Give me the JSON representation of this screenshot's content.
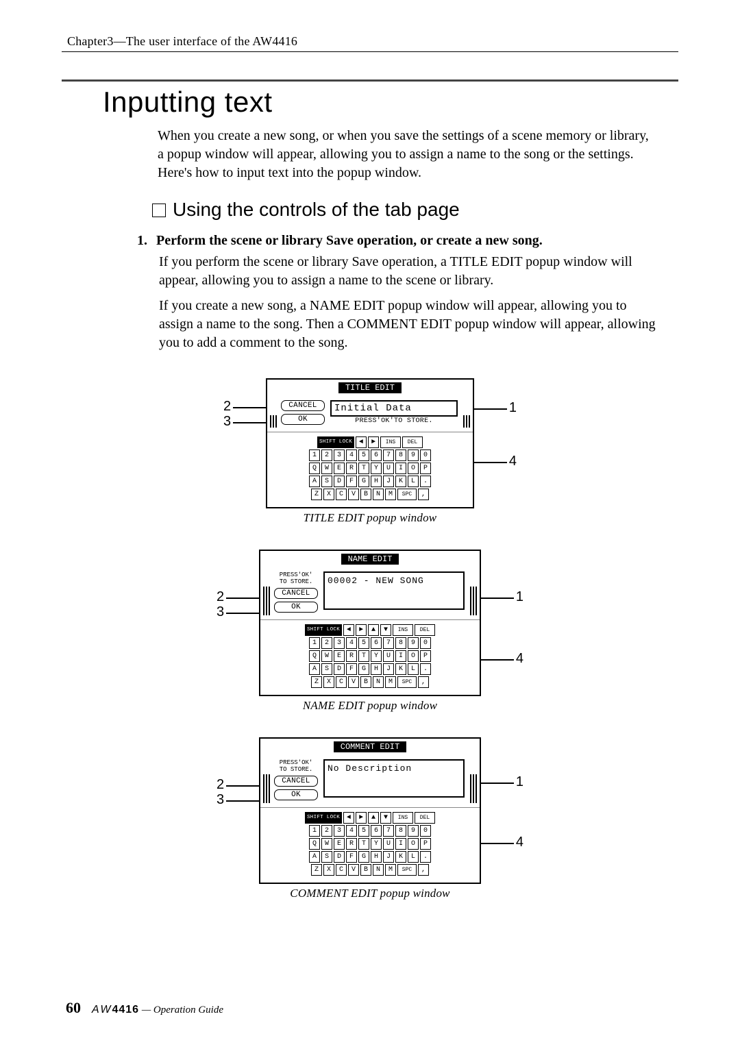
{
  "header": "Chapter3—The user interface of the AW4416",
  "title": "Inputting text",
  "intro": "When you create a new song, or when you save the settings of a scene memory or library, a popup window will appear, allowing you to assign a name to the song or the settings. Here's how to input text into the popup window.",
  "subhead": "Using the controls of the tab page",
  "step_num": "1.",
  "step_title": "Perform the scene or library Save operation, or create a new song.",
  "step_p1": "If you perform the scene or library Save operation, a TITLE EDIT popup window will appear, allowing you to assign a name to the scene or library.",
  "step_p2": "If you create a new song, a NAME EDIT popup window will appear, allowing you to assign a name to the song. Then a COMMENT EDIT popup window will appear, allowing you to add a comment to the song.",
  "popups": {
    "title_edit": {
      "bar": "TITLE EDIT",
      "field": "Initial Data",
      "below": "PRESS'OK'TO STORE.",
      "caption": "TITLE EDIT popup window"
    },
    "name_edit": {
      "bar": "NAME EDIT",
      "prompt1": "PRESS'OK'",
      "prompt2": "TO STORE.",
      "field": "00002 - NEW SONG",
      "caption": "NAME EDIT popup window"
    },
    "comment_edit": {
      "bar": "COMMENT EDIT",
      "prompt1": "PRESS'OK'",
      "prompt2": "TO STORE.",
      "field": "No Description",
      "caption": "COMMENT EDIT popup window"
    }
  },
  "buttons": {
    "cancel": "CANCEL",
    "ok": "OK"
  },
  "kb": {
    "shift": "SHIFT LOCK",
    "ins": "INS",
    "del": "DEL",
    "spc": "SPC",
    "row1": [
      "1",
      "2",
      "3",
      "4",
      "5",
      "6",
      "7",
      "8",
      "9",
      "0"
    ],
    "row2": [
      "Q",
      "W",
      "E",
      "R",
      "T",
      "Y",
      "U",
      "I",
      "O",
      "P"
    ],
    "row3": [
      "A",
      "S",
      "D",
      "F",
      "G",
      "H",
      "J",
      "K",
      "L",
      "."
    ],
    "row4": [
      "Z",
      "X",
      "C",
      "V",
      "B",
      "N",
      "M"
    ],
    "comma": ","
  },
  "callouts": {
    "c1": "1",
    "c2": "2",
    "c3": "3",
    "c4": "4"
  },
  "footer": {
    "page": "60",
    "logo": "AW",
    "model": "4416",
    "guide": " — Operation Guide"
  }
}
